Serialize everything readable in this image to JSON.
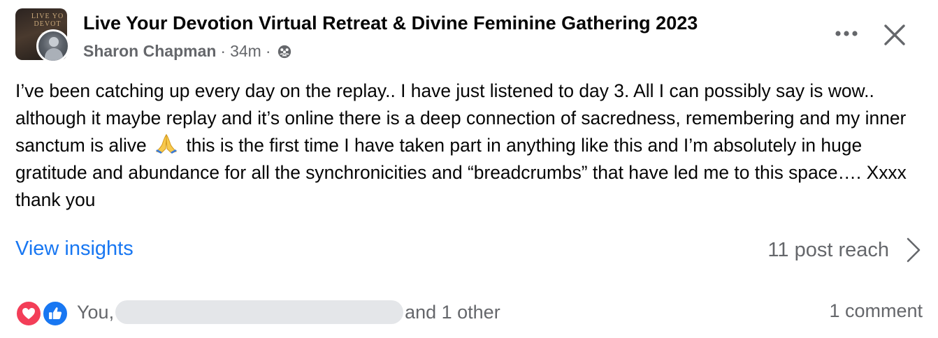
{
  "post": {
    "group_thumbnail_text": "LIVE YO DEVOT",
    "title": "Live Your Devotion Virtual Retreat & Divine Feminine Gathering 2023",
    "author": "Sharon Chapman",
    "separator": "·",
    "time": "34m",
    "privacy_icon": "members-icon",
    "menu_icon": "more-icon",
    "close_icon": "close-icon",
    "body_part1": "I’ve been catching up every day on the replay.. I have just listened to day 3. All I can possibly say is wow.. although it maybe replay and it’s online there is a deep connection of sacredness, remembering and my inner sanctum is alive",
    "emoji": "prayer-hands-icon",
    "body_part2": "this is the first time I have taken part in anything like this and I’m absolutely in huge gratitude and abundance for all the synchronicities and “breadcrumbs” that have led me to this space…. Xxxx thank you"
  },
  "insights": {
    "link_label": "View insights",
    "reach_label": "11 post reach"
  },
  "footer": {
    "reaction_icons": [
      "love-icon",
      "like-icon"
    ],
    "reactors_prefix": "You,",
    "reactors_suffix": "and 1 other",
    "comments_label": "1 comment"
  },
  "colors": {
    "link": "#1877f2",
    "secondary_text": "#65676b",
    "love": "#f33e58",
    "like": "#1877f2"
  }
}
